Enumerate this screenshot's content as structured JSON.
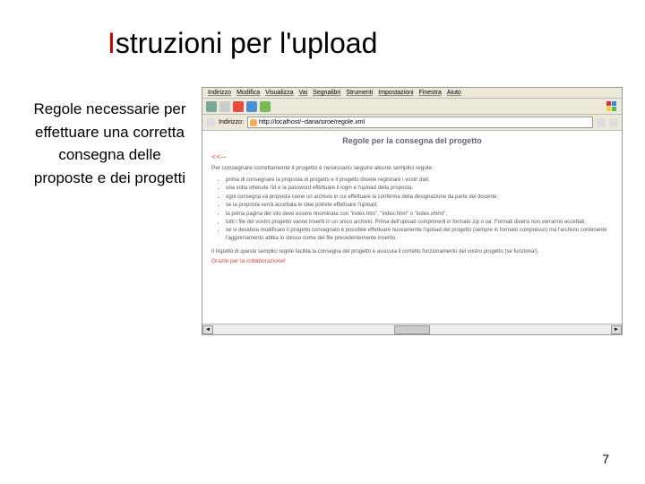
{
  "slide": {
    "title_accent": "I",
    "title_rest": "struzioni per l'upload",
    "page_number": "7"
  },
  "left": {
    "text": "Regole necessarie per effettuare una corretta consegna delle proposte e dei progetti"
  },
  "browser": {
    "menu": {
      "indirizzo": "Indirizzo",
      "modifica": "Modifica",
      "visualizza": "Visualizza",
      "vai": "Vai",
      "segnalibri": "Segnalibri",
      "strumenti": "Strumenti",
      "impostazioni": "Impostazioni",
      "finestra": "Finestra",
      "aiuto": "Aiuto"
    },
    "addr": {
      "label": "Indirizzo:",
      "url": "http://localhost/~daria/siroe/regole.xml"
    },
    "page": {
      "title": "Regole per la consegna del progetto",
      "back": "<<--",
      "intro": "Per consegnare correttamente il progetto è necessario seguire alcune semplici regole:",
      "rules": [
        "prima di consegnare la proposta di progetto e il progetto dovete registrare i vostri dati;",
        "una volta ottenute l'id e la password effettuare il login e l'upload della proposta;",
        "ogni consegna va proposta come un archivio in cui effettuare la conferma della designazione da parte del docente;",
        "se la proposta verrà accettata le idee potrete effettuare l'upload;",
        "la prima pagina del sito deve essere rinominata con \"index.htm\", \"index.html\" o \"index.xhtml\";",
        "tutti i file del vostro progetto vanno inseriti in un unico archivio. Prima dell'upload comprimerli in formato zip o rar. Formati diversi non verranno accettati;",
        "se si desidera modificare il progetto consegnato è possibile effettuare nuovamente l'upload del progetto (sempre in formato compresso) ma l'archivio contenente l'aggiornamento abbia lo stesso nome del file precedentemente inserito."
      ],
      "footer": "Il rispetto di queste semplici regole facilita la consegna del progetto e assicura il corretto funzionamento del vostro progetto (se funziona!).",
      "thanks": "Grazie per la collaborazione!"
    }
  }
}
